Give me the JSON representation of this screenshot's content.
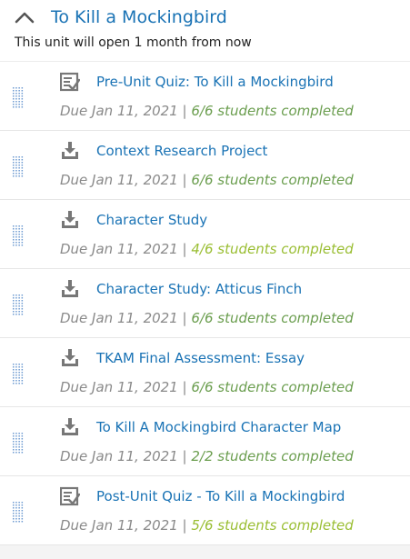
{
  "unit": {
    "title": "To Kill a Mockingbird",
    "subtitle": "This unit will open 1 month from now",
    "toggle_icon": "chevron-up-icon"
  },
  "colors": {
    "link": "#1a73b5",
    "due_text": "#8a8a8a",
    "complete_status": "#6b9e4f",
    "partial_status": "#9abe33",
    "icon_gray": "#777777",
    "drag_dots": "#6e9bd1"
  },
  "assignments": [
    {
      "icon": "quiz-icon",
      "title": "Pre-Unit Quiz: To Kill a Mockingbird",
      "due": "Due Jan 11, 2021",
      "separator": "|",
      "status": "6/6 students completed",
      "complete": true
    },
    {
      "icon": "download-icon",
      "title": "Context Research Project",
      "due": "Due Jan 11, 2021",
      "separator": "|",
      "status": "6/6 students completed",
      "complete": true
    },
    {
      "icon": "download-icon",
      "title": "Character Study",
      "due": "Due Jan 11, 2021",
      "separator": "|",
      "status": "4/6 students completed",
      "complete": false
    },
    {
      "icon": "download-icon",
      "title": "Character Study: Atticus Finch",
      "due": "Due Jan 11, 2021",
      "separator": "|",
      "status": "6/6 students completed",
      "complete": true
    },
    {
      "icon": "download-icon",
      "title": "TKAM Final Assessment: Essay",
      "due": "Due Jan 11, 2021",
      "separator": "|",
      "status": "6/6 students completed",
      "complete": true
    },
    {
      "icon": "download-icon",
      "title": "To Kill A Mockingbird Character Map",
      "due": "Due Jan 11, 2021",
      "separator": "|",
      "status": "2/2 students completed",
      "complete": true
    },
    {
      "icon": "quiz-icon",
      "title": "Post-Unit Quiz - To Kill a Mockingbird",
      "due": "Due Jan 11, 2021",
      "separator": "|",
      "status": "5/6 students completed",
      "complete": false
    }
  ]
}
